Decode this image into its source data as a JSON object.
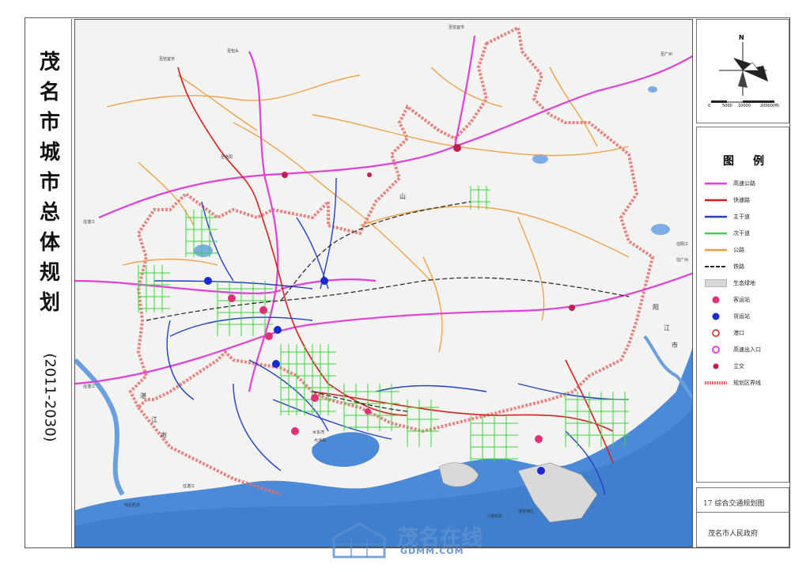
{
  "title": {
    "chars": [
      "茂",
      "名",
      "市",
      "城",
      "市",
      "总",
      "体",
      "规",
      "划"
    ],
    "years": "(2011-2030)"
  },
  "map": {
    "places": {
      "to_xinyi_top": "至信宜市",
      "to_xinyi_left": "至信宜市",
      "to_baotou": "至包头",
      "to_guangzhou": "至广州",
      "to_luoyang": "至洛阳",
      "to_zhanjiang_1": "往湛江",
      "to_zhanjiang_2": "往湛江",
      "to_zhanjiang_3": "往湛江",
      "to_guangzhou_2": "往广州",
      "to_yangjiang": "往阳江",
      "zhan": "湛",
      "jiang": "江",
      "shi": "市",
      "yang": "阳",
      "jiang2": "江",
      "shi2": "市",
      "shuidong": "水东湾",
      "dazhou": "大洲岛",
      "zhanjiang_airport": "茂名机场",
      "shan": "山",
      "port": "博贺港区",
      "xiaofang": "小放鸡岛"
    },
    "scale_labels": [
      "0",
      "5000",
      "10000",
      "20000(M)"
    ],
    "north": "N"
  },
  "legend": {
    "title": "图例",
    "items": [
      {
        "label": "高速公路",
        "color": "#e040d8",
        "kind": "line"
      },
      {
        "label": "快速路",
        "color": "#d62020",
        "kind": "line"
      },
      {
        "label": "主干道",
        "color": "#2040c8",
        "kind": "line"
      },
      {
        "label": "次干道",
        "color": "#39d63a",
        "kind": "line"
      },
      {
        "label": "公路",
        "color": "#f09a3a",
        "kind": "line"
      },
      {
        "label": "铁路",
        "color": "#222222",
        "kind": "rail"
      },
      {
        "label": "生态绿地",
        "color": "#d8d8d8",
        "kind": "fill"
      },
      {
        "label": "客运站",
        "color": "#e0307a",
        "kind": "dot"
      },
      {
        "label": "货运站",
        "color": "#1a2ad0",
        "kind": "dot"
      },
      {
        "label": "港口",
        "color": "#d62020",
        "kind": "ring"
      },
      {
        "label": "高速出入口",
        "color": "#e040d8",
        "kind": "ring2"
      },
      {
        "label": "立交",
        "color": "#c02050",
        "kind": "smalldot"
      },
      {
        "label": "规划区界线",
        "color": "#e07070",
        "kind": "boundary"
      }
    ]
  },
  "caption": "17  综合交通规划图",
  "issuer": "茂名市人民政府",
  "watermark": {
    "text": "茂名在线",
    "url": "GDMM.COM"
  },
  "colors": {
    "sea": "#4a8ad8",
    "land": "#f3f3f1",
    "boundary": "#e07070",
    "expressway": "#e040d8",
    "arterial": "#2040c8",
    "secondary": "#39d63a",
    "highway": "#f09a3a",
    "fastroad": "#d62020"
  }
}
